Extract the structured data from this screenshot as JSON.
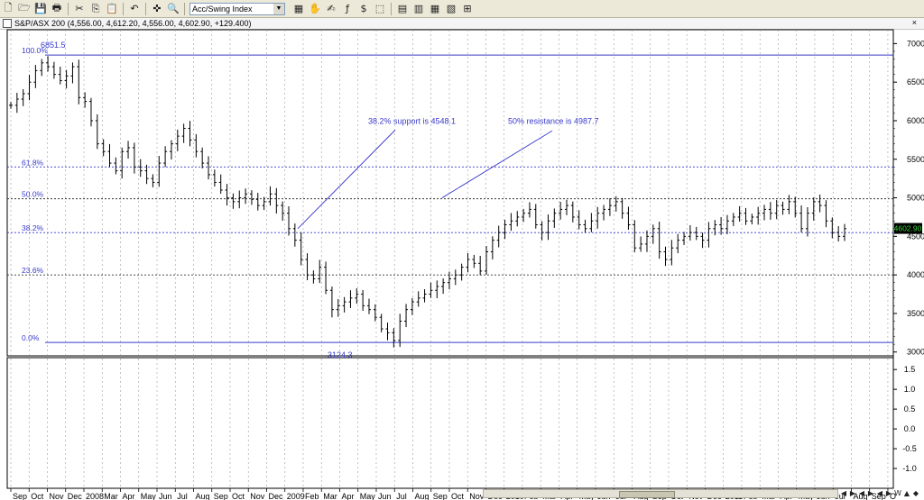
{
  "toolbar": {
    "icons": [
      "new-icon",
      "open-icon",
      "save-icon",
      "print-icon",
      "cut-icon",
      "copy-icon",
      "paste-icon",
      "undo-icon",
      "crosshair-icon",
      "zoom-icon",
      "indicator-icon",
      "pan-icon",
      "annotation-icon",
      "function-icon",
      "dollar-icon",
      "layout-icon",
      "grid-icon"
    ],
    "glyphs": [
      "🗋",
      "🗁",
      "💾",
      "🖶",
      "✂",
      "⎘",
      "📋",
      "↶",
      "✜",
      "🔍",
      "▦",
      "✋",
      "✍",
      "ƒ",
      "$",
      "⬚",
      "▤",
      "▥",
      "▦",
      "▧",
      "⊞"
    ],
    "indicator_selected": "Acc/Swing Index"
  },
  "titlebar": {
    "symbol": "S&P/ASX 200",
    "ohlc": "(4,556.00, 4,612.20, 4,556.00, 4,602.90, +129.400)",
    "close_glyph": "×"
  },
  "chart_data": {
    "type": "ohlc",
    "title": "S&P/ASX 200",
    "ohlc": {
      "open": 4556.0,
      "high": 4612.2,
      "low": 4556.0,
      "close": 4602.9,
      "change": 129.4
    },
    "ylim": [
      2950,
      7180
    ],
    "y_ticks": [
      3000,
      3500,
      4000,
      4500,
      5000,
      5500,
      6000,
      6500,
      7000
    ],
    "last_price_label": "4602.90",
    "x_labels": [
      "Sep",
      "Oct",
      "Nov",
      "Dec",
      "2008",
      "Mar",
      "Apr",
      "May",
      "Jun",
      "Jul",
      "Aug",
      "Sep",
      "Oct",
      "Nov",
      "Dec",
      "2009",
      "Feb",
      "Mar",
      "Apr",
      "May",
      "Jun",
      "Jul",
      "Aug",
      "Sep",
      "Oct",
      "Nov",
      "Dec",
      "2010",
      "Feb",
      "Mar",
      "Apr",
      "May",
      "Jun",
      "Jul",
      "Aug",
      "Sep",
      "Oct",
      "Nov",
      "Dec",
      "2011",
      "Feb",
      "Mar",
      "Apr",
      "May",
      "Jun",
      "Jul",
      "Aug",
      "Sep",
      "O"
    ],
    "fibonacci": {
      "levels": [
        {
          "label": "100.0%",
          "value": 6851.5
        },
        {
          "label": "61.8%",
          "value": 5400
        },
        {
          "label": "50.0%",
          "value": 4987.7
        },
        {
          "label": "38.2%",
          "value": 4548.1
        },
        {
          "label": "23.6%",
          "value": 4000
        },
        {
          "label": "0.0%",
          "value": 3124.3
        }
      ],
      "high_label": "6851.5",
      "low_label": "3124.3"
    },
    "annotations": [
      {
        "text": "38.2% support is 4548.1"
      },
      {
        "text": "50% resistance is 4987.7"
      }
    ],
    "close_series": [
      6200,
      6280,
      6350,
      6500,
      6650,
      6750,
      6700,
      6600,
      6520,
      6580,
      6700,
      6300,
      6250,
      6000,
      5700,
      5600,
      5450,
      5350,
      5600,
      5650,
      5400,
      5350,
      5250,
      5200,
      5450,
      5600,
      5700,
      5800,
      5900,
      5750,
      5600,
      5450,
      5300,
      5200,
      5100,
      5000,
      4950,
      5000,
      5050,
      4980,
      4900,
      4950,
      5050,
      4900,
      4800,
      4600,
      4450,
      4200,
      4000,
      3950,
      4100,
      3800,
      3550,
      3600,
      3650,
      3700,
      3750,
      3600,
      3550,
      3450,
      3300,
      3250,
      3150,
      3400,
      3550,
      3650,
      3700,
      3750,
      3800,
      3850,
      3900,
      3950,
      4000,
      4100,
      4200,
      4150,
      4050,
      4300,
      4450,
      4550,
      4650,
      4700,
      4750,
      4800,
      4850,
      4650,
      4550,
      4700,
      4800,
      4850,
      4900,
      4750,
      4650,
      4600,
      4700,
      4800,
      4850,
      4900,
      4950,
      4800,
      4650,
      4350,
      4400,
      4500,
      4600,
      4300,
      4200,
      4350,
      4450,
      4500,
      4550,
      4500,
      4450,
      4600,
      4650,
      4600,
      4700,
      4750,
      4800,
      4700,
      4750,
      4800,
      4850,
      4800,
      4900,
      4850,
      4950,
      4800,
      4600,
      4800,
      4950,
      4900,
      4700,
      4550,
      4500,
      4600
    ],
    "lower_panel": {
      "name": "Acc/Swing Index",
      "ylim": [
        -1.5,
        1.8
      ],
      "y_ticks": [
        1.5,
        1.0,
        0.5,
        0.0,
        -0.5,
        -1.0
      ]
    }
  },
  "nav": {
    "glyphs": [
      "◀",
      "▶",
      "◀",
      "▶",
      "◀",
      "▶",
      "W",
      "▲",
      "◆"
    ]
  }
}
